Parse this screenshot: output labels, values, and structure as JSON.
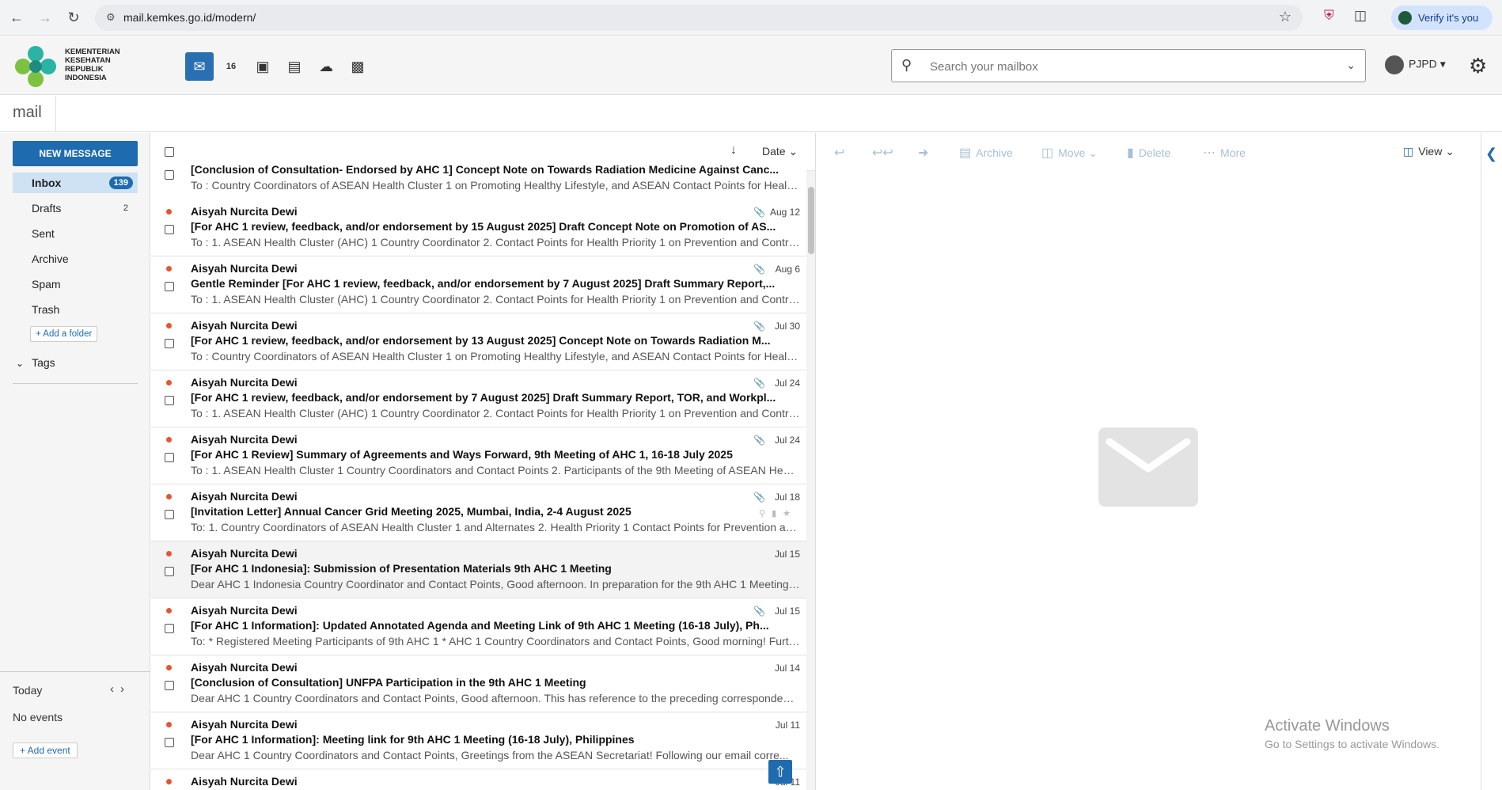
{
  "browser": {
    "url": "mail.kemkes.go.id/modern/",
    "verify_label": "Verify it's you"
  },
  "header": {
    "logo_lines": [
      "KEMENTERIAN",
      "KESEHATAN",
      "REPUBLIK",
      "INDONESIA"
    ],
    "nav_icons": [
      "mail-icon",
      "calendar-icon",
      "briefcase-icon",
      "chat-icon",
      "cloud-icon",
      "contacts-icon"
    ],
    "calendar_day": "16",
    "search_placeholder": "Search your mailbox",
    "user_name": "PJPD",
    "colors": {
      "accent": "#1f6bb0",
      "unread_dot": "#e4572e"
    }
  },
  "title": "mail",
  "sidebar": {
    "new_message_label": "NEW MESSAGE",
    "folders": [
      {
        "label": "Inbox",
        "count": "139"
      },
      {
        "label": "Drafts",
        "count": "2"
      },
      {
        "label": "Sent",
        "count": ""
      },
      {
        "label": "Archive",
        "count": ""
      },
      {
        "label": "Spam",
        "count": ""
      },
      {
        "label": "Trash",
        "count": ""
      }
    ],
    "add_folder_label": "+ Add a folder",
    "tags_label": "Tags",
    "calendar": {
      "today_label": "Today",
      "no_events_label": "No events",
      "add_event_label": "+ Add event"
    }
  },
  "list": {
    "sort_label": "Date",
    "emails": [
      {
        "from": "",
        "subject": "[Conclusion of Consultation- Endorsed by AHC 1] Concept Note on Towards Radiation Medicine Against Canc...",
        "preview": "To : Country Coordinators of ASEAN Health Cluster 1 on Promoting Healthy Lifestyle, and ASEAN Contact Points for Health...",
        "date": "",
        "attachment": false,
        "unread": false
      },
      {
        "from": "Aisyah Nurcita Dewi",
        "subject": "[For AHC 1 review, feedback, and/or endorsement by 15 August 2025] Draft Concept Note on Promotion of AS...",
        "preview": "To : 1. ASEAN Health Cluster (AHC) 1 Country Coordinator 2. Contact Points for Health Priority 1 on Prevention and Control ...",
        "date": "Aug 12",
        "attachment": true,
        "unread": true
      },
      {
        "from": "Aisyah Nurcita Dewi",
        "subject": "Gentle Reminder [For AHC 1 review, feedback, and/or endorsement by 7 August 2025] Draft Summary Report,...",
        "preview": "To : 1. ASEAN Health Cluster (AHC) 1 Country Coordinator 2. Contact Points for Health Priority 1 on Prevention and Control ...",
        "date": "Aug 6",
        "attachment": true,
        "unread": true
      },
      {
        "from": "Aisyah Nurcita Dewi",
        "subject": "[For AHC 1 review, feedback, and/or endorsement by 13 August 2025] Concept Note on Towards Radiation M...",
        "preview": "To : Country Coordinators of ASEAN Health Cluster 1 on Promoting Healthy Lifestyle, and ASEAN Contact Points for Health...",
        "date": "Jul 30",
        "attachment": true,
        "unread": true
      },
      {
        "from": "Aisyah Nurcita Dewi",
        "subject": "[For AHC 1 review, feedback, and/or endorsement by 7 August 2025] Draft Summary Report, TOR, and Workpl...",
        "preview": "To : 1. ASEAN Health Cluster (AHC) 1 Country Coordinator 2. Contact Points for Health Priority 1 on Prevention and Control ...",
        "date": "Jul 24",
        "attachment": true,
        "unread": true
      },
      {
        "from": "Aisyah Nurcita Dewi",
        "subject": "[For AHC 1 Review] Summary of Agreements and Ways Forward, 9th Meeting of AHC 1, 16-18 July 2025",
        "preview": "To : 1. ASEAN Health Cluster 1 Country Coordinators and Contact Points 2. Participants of the 9th Meeting of ASEAN Healt...",
        "date": "Jul 24",
        "attachment": true,
        "unread": true
      },
      {
        "from": "Aisyah Nurcita Dewi",
        "subject": "[Invitation Letter] Annual Cancer Grid Meeting 2025, Mumbai, India, 2-4 August 2025",
        "preview": "To: 1. Country Coordinators of ASEAN Health Cluster 1 and Alternates 2. Health Priority 1 Contact Points for Prevention an...",
        "date": "Jul 18",
        "attachment": true,
        "unread": true
      },
      {
        "from": "Aisyah Nurcita Dewi",
        "subject": "[For AHC 1 Indonesia]: Submission of Presentation Materials 9th AHC 1 Meeting",
        "preview": "Dear AHC 1 Indonesia Country Coordinator and Contact Points, Good afternoon. In preparation for the 9th AHC 1 Meeting t...",
        "date": "Jul 15",
        "attachment": false,
        "unread": true
      },
      {
        "from": "Aisyah Nurcita Dewi",
        "subject": "[For AHC 1 Information]: Updated Annotated Agenda and Meeting Link of 9th AHC 1 Meeting (16-18 July), Ph...",
        "preview": "To: * Registered Meeting Participants of 9th AHC 1 * AHC 1 Country Coordinators and Contact Points, Good morning! Furth...",
        "date": "Jul 15",
        "attachment": true,
        "unread": true
      },
      {
        "from": "Aisyah Nurcita Dewi",
        "subject": "[Conclusion of Consultation] UNFPA Participation in the 9th AHC 1 Meeting",
        "preview": "Dear AHC 1 Country Coordinators and Contact Points, Good afternoon. This has reference to the preceding correspondenc...",
        "date": "Jul 14",
        "attachment": false,
        "unread": true
      },
      {
        "from": "Aisyah Nurcita Dewi",
        "subject": "[For AHC 1 Information]: Meeting link for 9th AHC 1 Meeting (16-18 July), Philippines",
        "preview": "Dear AHC 1 Country Coordinators and Contact Points, Greetings from the ASEAN Secretariat! Following our email corre...",
        "date": "Jul 11",
        "attachment": false,
        "unread": true
      },
      {
        "from": "Aisyah Nurcita Dewi",
        "subject": "",
        "preview": "",
        "date": "Jul 11",
        "attachment": false,
        "unread": true
      }
    ]
  },
  "reader": {
    "toolbar": {
      "archive": "Archive",
      "move": "Move",
      "delete": "Delete",
      "more": "More",
      "view": "View"
    }
  },
  "watermark": {
    "line1": "Activate Windows",
    "line2": "Go to Settings to activate Windows."
  }
}
